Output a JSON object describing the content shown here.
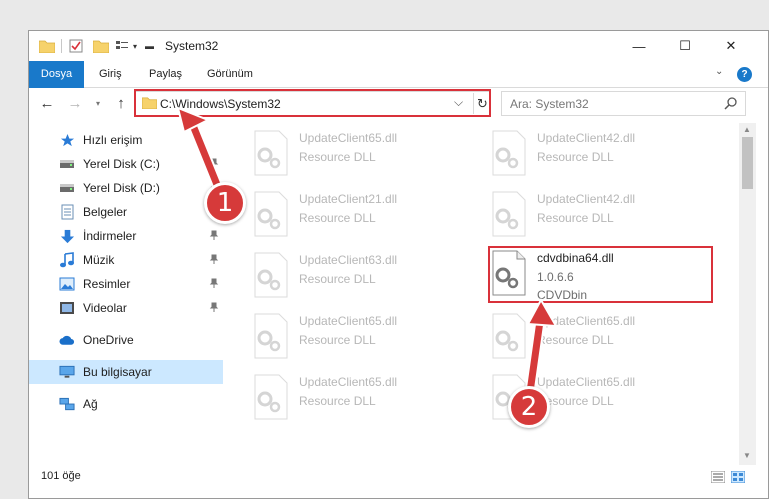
{
  "window": {
    "title": "System32",
    "minimize_glyph": "—",
    "maximize_glyph": "☐",
    "close_glyph": "✕"
  },
  "ribbon": {
    "tabs": [
      {
        "label": "Dosya",
        "active": true
      },
      {
        "label": "Giriş"
      },
      {
        "label": "Paylaş"
      },
      {
        "label": "Görünüm"
      }
    ],
    "expand_glyph": "⌄",
    "help_glyph": "?"
  },
  "nav": {
    "back_glyph": "←",
    "forward_glyph": "→",
    "recent_glyph": "▾",
    "up_glyph": "↑",
    "address": "C:\\Windows\\System32",
    "address_dropdown_glyph": "⌵",
    "refresh_glyph": "↻",
    "search_placeholder": "Ara: System32"
  },
  "sidebar": {
    "items": [
      {
        "label": "Hızlı erişim",
        "icon": "star-icon",
        "pinned": false
      },
      {
        "label": "Yerel Disk (C:)",
        "icon": "drive-icon",
        "pinned": true
      },
      {
        "label": "Yerel Disk (D:)",
        "icon": "drive-icon",
        "pinned": true
      },
      {
        "label": "Belgeler",
        "icon": "documents-icon",
        "pinned": true
      },
      {
        "label": "İndirmeler",
        "icon": "download-icon",
        "pinned": true
      },
      {
        "label": "Müzik",
        "icon": "music-icon",
        "pinned": true
      },
      {
        "label": "Resimler",
        "icon": "pictures-icon",
        "pinned": true
      },
      {
        "label": "Videolar",
        "icon": "videos-icon",
        "pinned": true
      },
      {
        "label": "OneDrive",
        "icon": "cloud-icon",
        "pinned": false
      },
      {
        "label": "Bu bilgisayar",
        "icon": "computer-icon",
        "pinned": false,
        "selected": true
      },
      {
        "label": "Ağ",
        "icon": "network-icon",
        "pinned": false
      }
    ],
    "pin_glyph": "📌"
  },
  "files": [
    {
      "name": "UpdateClient65.dll",
      "line2": "Resource DLL",
      "line3": "",
      "highlighted": false
    },
    {
      "name": "UpdateClient42.dll",
      "line2": "Resource DLL",
      "line3": "",
      "highlighted": false
    },
    {
      "name": "UpdateClient21.dll",
      "line2": "Resource DLL",
      "line3": "",
      "highlighted": false
    },
    {
      "name": "UpdateClient42.dll",
      "line2": "Resource DLL",
      "line3": "",
      "highlighted": false
    },
    {
      "name": "UpdateClient63.dll",
      "line2": "Resource DLL",
      "line3": "",
      "highlighted": false
    },
    {
      "name": "cdvdbina64.dll",
      "line2": "1.0.6.6",
      "line3": "CDVDbin",
      "highlighted": true
    },
    {
      "name": "UpdateClient65.dll",
      "line2": "Resource DLL",
      "line3": "",
      "highlighted": false
    },
    {
      "name": "UpdateClient65.dll",
      "line2": "Resource DLL",
      "line3": "",
      "highlighted": false
    },
    {
      "name": "UpdateClient65.dll",
      "line2": "Resource DLL",
      "line3": "",
      "highlighted": false
    },
    {
      "name": "UpdateClient65.dll",
      "line2": "Resource DLL",
      "line3": "",
      "highlighted": false
    }
  ],
  "status": {
    "item_count": "101 öğe"
  },
  "annotations": {
    "step1": "1",
    "step2": "2",
    "color": "#d63a3a"
  }
}
